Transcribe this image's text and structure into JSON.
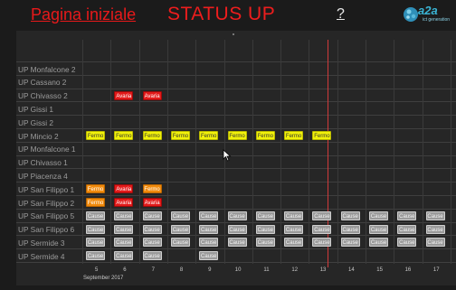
{
  "header": {
    "home_link": "Pagina iniziale",
    "title": "STATUS UP",
    "help": "?",
    "logo_text": "a2a",
    "logo_sub": "ict generation"
  },
  "rows": [
    {
      "label": "UP Monfalcone 2",
      "cells": []
    },
    {
      "label": "UP Cassano 2",
      "cells": []
    },
    {
      "label": "UP Chivasso 2",
      "cells": [
        {
          "col": 1,
          "type": "avaria",
          "text": "Avaria"
        },
        {
          "col": 2,
          "type": "avaria",
          "text": "Avaria"
        }
      ]
    },
    {
      "label": "UP Gissi 1",
      "cells": []
    },
    {
      "label": "UP Gissi 2",
      "cells": []
    },
    {
      "label": "UP Mincio 2",
      "cells": [
        {
          "col": 0,
          "type": "fermo",
          "text": "Fermo"
        },
        {
          "col": 1,
          "type": "fermo",
          "text": "Fermo"
        },
        {
          "col": 2,
          "type": "fermo",
          "text": "Fermo"
        },
        {
          "col": 3,
          "type": "fermo",
          "text": "Fermo"
        },
        {
          "col": 4,
          "type": "fermo",
          "text": "Fermo"
        },
        {
          "col": 5,
          "type": "fermo",
          "text": "Fermo"
        },
        {
          "col": 6,
          "type": "fermo",
          "text": "Fermo"
        },
        {
          "col": 7,
          "type": "fermo",
          "text": "Fermo"
        },
        {
          "col": 8,
          "type": "fermo",
          "text": "Fermo"
        }
      ]
    },
    {
      "label": "UP Monfalcone 1",
      "cells": []
    },
    {
      "label": "UP Chivasso 1",
      "cells": []
    },
    {
      "label": "UP Piacenza 4",
      "cells": []
    },
    {
      "label": "UP San Filippo 1",
      "cells": [
        {
          "col": 0,
          "type": "fermo-o",
          "text": "Fermo"
        },
        {
          "col": 1,
          "type": "avaria",
          "text": "Avaria"
        },
        {
          "col": 2,
          "type": "fermo-o",
          "text": "Fermo"
        }
      ]
    },
    {
      "label": "UP San Filippo 2",
      "cells": [
        {
          "col": 0,
          "type": "fermo-o",
          "text": "Fermo"
        },
        {
          "col": 1,
          "type": "avaria",
          "text": "Avaria"
        },
        {
          "col": 2,
          "type": "avaria",
          "text": "Avaria"
        }
      ]
    },
    {
      "label": "UP San Filippo 5",
      "cells": [
        {
          "col": 0,
          "type": "cause",
          "text": "Cause"
        },
        {
          "col": 1,
          "type": "cause",
          "text": "Cause"
        },
        {
          "col": 2,
          "type": "cause",
          "text": "Cause"
        },
        {
          "col": 3,
          "type": "cause",
          "text": "Cause"
        },
        {
          "col": 4,
          "type": "cause",
          "text": "Cause"
        },
        {
          "col": 5,
          "type": "cause",
          "text": "Cause"
        },
        {
          "col": 6,
          "type": "cause",
          "text": "Cause"
        },
        {
          "col": 7,
          "type": "cause",
          "text": "Cause"
        },
        {
          "col": 8,
          "type": "cause",
          "text": "Cause"
        },
        {
          "col": 9,
          "type": "cause",
          "text": "Cause"
        },
        {
          "col": 10,
          "type": "cause",
          "text": "Cause"
        },
        {
          "col": 11,
          "type": "cause",
          "text": "Cause"
        },
        {
          "col": 12,
          "type": "cause",
          "text": "Cause"
        }
      ]
    },
    {
      "label": "UP San Filippo 6",
      "cells": [
        {
          "col": 0,
          "type": "cause",
          "text": "Cause"
        },
        {
          "col": 1,
          "type": "cause",
          "text": "Cause"
        },
        {
          "col": 2,
          "type": "cause",
          "text": "Cause"
        },
        {
          "col": 3,
          "type": "cause",
          "text": "Cause"
        },
        {
          "col": 4,
          "type": "cause",
          "text": "Cause"
        },
        {
          "col": 5,
          "type": "cause",
          "text": "Cause"
        },
        {
          "col": 6,
          "type": "cause",
          "text": "Cause"
        },
        {
          "col": 7,
          "type": "cause",
          "text": "Cause"
        },
        {
          "col": 8,
          "type": "cause",
          "text": "Cause"
        },
        {
          "col": 9,
          "type": "cause",
          "text": "Cause"
        },
        {
          "col": 10,
          "type": "cause",
          "text": "Cause"
        },
        {
          "col": 11,
          "type": "cause",
          "text": "Cause"
        },
        {
          "col": 12,
          "type": "cause",
          "text": "Cause"
        }
      ]
    },
    {
      "label": "UP Sermide 3",
      "cells": [
        {
          "col": 0,
          "type": "cause",
          "text": "Cause"
        },
        {
          "col": 1,
          "type": "cause",
          "text": "Cause"
        },
        {
          "col": 2,
          "type": "cause",
          "text": "Cause"
        },
        {
          "col": 3,
          "type": "cause",
          "text": "Cause"
        },
        {
          "col": 4,
          "type": "cause",
          "text": "Cause"
        },
        {
          "col": 5,
          "type": "cause",
          "text": "Cause"
        },
        {
          "col": 6,
          "type": "cause",
          "text": "Cause"
        },
        {
          "col": 7,
          "type": "cause",
          "text": "Cause"
        },
        {
          "col": 8,
          "type": "cause",
          "text": "Cause"
        },
        {
          "col": 9,
          "type": "cause",
          "text": "Cause"
        },
        {
          "col": 10,
          "type": "cause",
          "text": "Cause"
        },
        {
          "col": 11,
          "type": "cause",
          "text": "Cause"
        },
        {
          "col": 12,
          "type": "cause",
          "text": "Cause"
        }
      ]
    },
    {
      "label": "UP Sermide 4",
      "cells": [
        {
          "col": 0,
          "type": "cause",
          "text": "Cause"
        },
        {
          "col": 1,
          "type": "cause",
          "text": "Cause"
        },
        {
          "col": 2,
          "type": "cause",
          "text": "Cause"
        },
        {
          "col": 4,
          "type": "cause",
          "text": "Cause"
        }
      ]
    }
  ],
  "days": [
    "5",
    "6",
    "7",
    "8",
    "9",
    "10",
    "11",
    "12",
    "13",
    "14",
    "15",
    "16",
    "17"
  ],
  "month_label": "September 2017",
  "today_index": 8
}
